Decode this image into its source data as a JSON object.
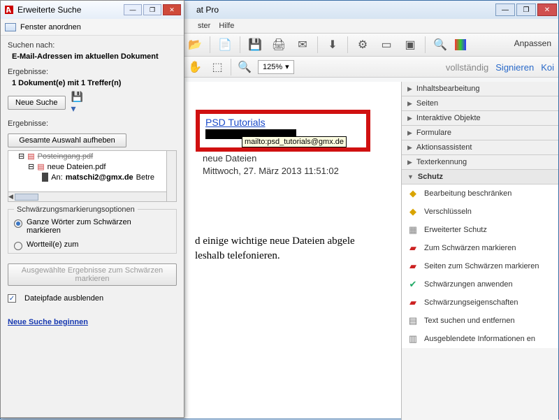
{
  "mainWindow": {
    "titleSuffix": "at Pro",
    "menu": {
      "m1": "ster",
      "m2": "Hilfe"
    },
    "anpassen": "Anpassen",
    "zoom": "125%",
    "rightTabs": {
      "voll": "vollständig",
      "sign": "Signieren",
      "kom": "Koi"
    }
  },
  "doc": {
    "link": "PSD Tutorials",
    "tooltip": "mailto:psd_tutorials@gmx.de",
    "sub": "neue Dateien",
    "date": "Mittwoch, 27. März 2013 11:51:02",
    "bodyLine1": "d einige wichtige neue Dateien abgele",
    "bodyLine2": "leshalb telefonieren."
  },
  "panels": {
    "p1": "Inhaltsbearbeitung",
    "p2": "Seiten",
    "p3": "Interaktive Objekte",
    "p4": "Formulare",
    "p5": "Aktionsassistent",
    "p6": "Texterkennung",
    "p7": "Schutz"
  },
  "schutz": {
    "s1": "Bearbeitung beschränken",
    "s2": "Verschlüsseln",
    "s3": "Erweiterter Schutz",
    "s4": "Zum Schwärzen markieren",
    "s5": "Seiten zum Schwärzen markieren",
    "s6": "Schwärzungen anwenden",
    "s7": "Schwärzungseigenschaften",
    "s8": "Text suchen und entfernen",
    "s9": "Ausgeblendete Informationen en"
  },
  "search": {
    "title": "Erweiterte Suche",
    "arrange": "Fenster anordnen",
    "suchenNach": "Suchen nach:",
    "query": "E-Mail-Adressen im aktuellen Dokument",
    "ergebnisse": "Ergebnisse:",
    "summary": "1 Dokument(e) mit 1 Treffer(n)",
    "neueSuche": "Neue Suche",
    "deselect": "Gesamte Auswahl aufheben",
    "tree": {
      "l1": "Posteingang.pdf",
      "l2": "neue Dateien.pdf",
      "l3a": "An: ",
      "l3b": "matschi2@gmx.de",
      "l3c": " Betre"
    },
    "opts": {
      "group": "Schwärzungsmarkierungsoptionen",
      "r1": "Ganze Wörter zum Schwärzen markieren",
      "r2": "Wortteil(e) zum"
    },
    "markBtn": "Ausgewählte Ergebnisse zum Schwärzen markieren",
    "hidePaths": "Dateipfade ausblenden",
    "newSearch": "Neue Suche beginnen"
  }
}
